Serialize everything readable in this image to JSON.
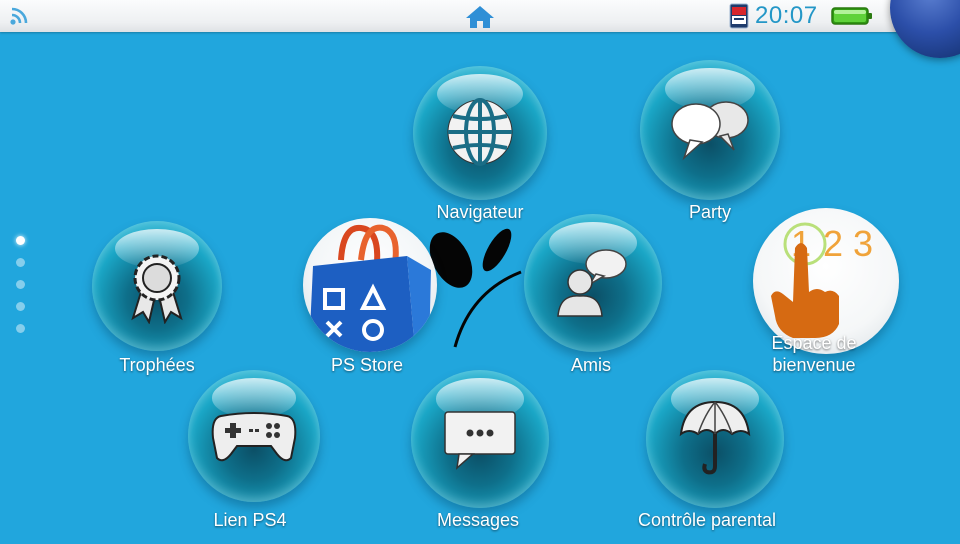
{
  "status_bar": {
    "time": "20:07",
    "icons": [
      "wifi-icon",
      "home-icon",
      "app-notification-icon",
      "battery-icon"
    ],
    "battery_color": "#3fbf1f"
  },
  "pages": {
    "count": 5,
    "active": 1
  },
  "apps": [
    {
      "label": "Navigateur",
      "icon": "globe-icon"
    },
    {
      "label": "Party",
      "icon": "speech-bubbles-icon"
    },
    {
      "label": "Trophées",
      "icon": "trophy-ribbon-icon"
    },
    {
      "label": "PS Store",
      "icon": "shopping-bag-icon"
    },
    {
      "label": "Amis",
      "icon": "friends-icon"
    },
    {
      "label": "Espace de bienvenue",
      "label_line1": "Espace de",
      "label_line2": "bienvenue",
      "icon": "hand-123-icon"
    },
    {
      "label": "Lien PS4",
      "icon": "gamepad-icon"
    },
    {
      "label": "Messages",
      "icon": "message-icon"
    },
    {
      "label": "Contrôle parental",
      "icon": "umbrella-icon"
    }
  ],
  "colors": {
    "background": "#21a6dd",
    "bubble": "#1aa6c6",
    "status_bar": "#f3f5f7",
    "clock": "#2497c7"
  }
}
